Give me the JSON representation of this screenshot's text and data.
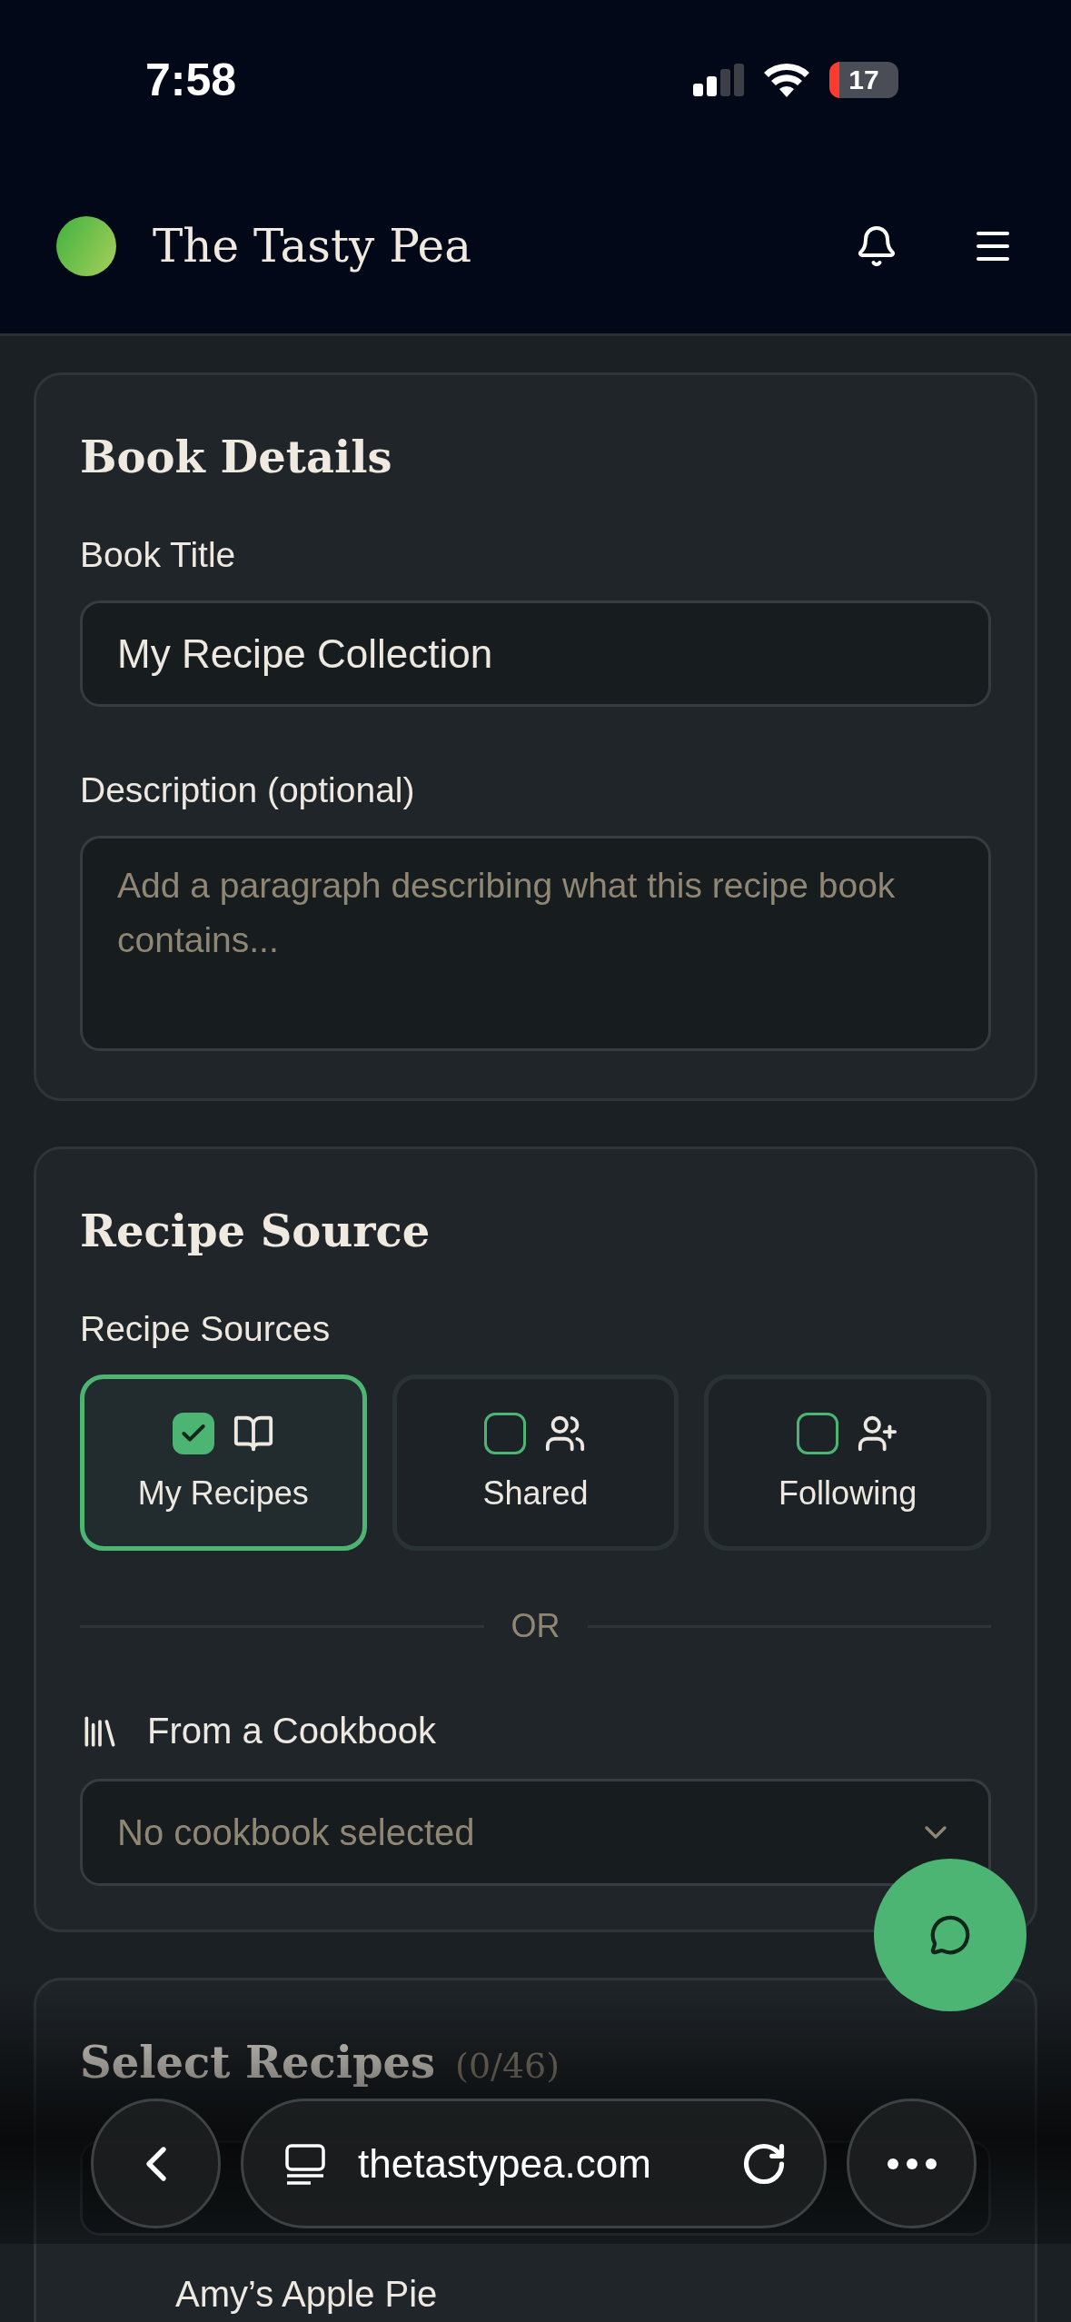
{
  "status_bar": {
    "time": "7:58",
    "battery": "17"
  },
  "header": {
    "title": "The Tasty Pea"
  },
  "book_details": {
    "title": "Book Details",
    "title_label": "Book Title",
    "title_value": "My Recipe Collection",
    "description_label": "Description (optional)",
    "description_placeholder": "Add a paragraph describing what this recipe book contains..."
  },
  "recipe_source": {
    "title": "Recipe Source",
    "sources_label": "Recipe Sources",
    "sources": [
      {
        "label": "My Recipes",
        "kind": "book",
        "selected": true
      },
      {
        "label": "Shared",
        "kind": "people",
        "selected": false
      },
      {
        "label": "Following",
        "kind": "person-add",
        "selected": false
      }
    ],
    "divider": "OR",
    "cookbook_label": "From a Cookbook",
    "cookbook_select": "No cookbook selected"
  },
  "select_recipes": {
    "title": "Select Recipes",
    "count": "(0/46)",
    "items": [
      "Amy’s Apple Pie"
    ]
  },
  "browser_bar": {
    "url": "thetastypea.com"
  }
}
